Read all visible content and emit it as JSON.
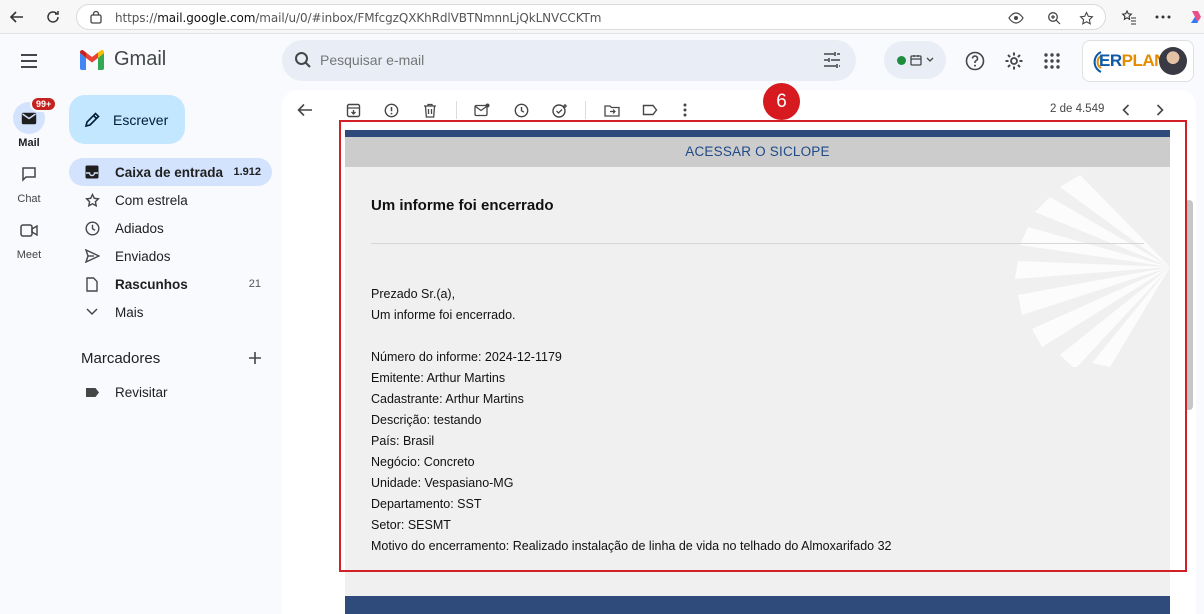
{
  "browser": {
    "url_prefix": "https://",
    "url_host": "mail.google.com",
    "url_path": "/mail/u/0/#inbox/FMfcgzQXKhRdlVBTNmnnLjQkLNVCCKTm"
  },
  "app": {
    "name": "Gmail"
  },
  "rail": {
    "mail_label": "Mail",
    "mail_badge": "99+",
    "chat_label": "Chat",
    "meet_label": "Meet"
  },
  "search": {
    "placeholder": "Pesquisar e-mail"
  },
  "account": {
    "brand_prefix": "ER",
    "brand_suffix": "PLAN"
  },
  "compose": {
    "label": "Escrever"
  },
  "nav": [
    {
      "label": "Caixa de entrada",
      "count": "1.912"
    },
    {
      "label": "Com estrela",
      "count": ""
    },
    {
      "label": "Adiados",
      "count": ""
    },
    {
      "label": "Enviados",
      "count": ""
    },
    {
      "label": "Rascunhos",
      "count": "21"
    },
    {
      "label": "Mais",
      "count": ""
    }
  ],
  "labels": {
    "title": "Marcadores",
    "items": [
      {
        "label": "Revisitar"
      }
    ]
  },
  "pager": {
    "text": "2 de 4.549"
  },
  "annotation": {
    "number": "6"
  },
  "email": {
    "access_link": "ACESSAR O SICLOPE",
    "heading": "Um informe foi encerrado",
    "greeting": "Prezado Sr.(a),",
    "intro": "Um informe foi encerrado.",
    "fields": [
      "Número do informe: 2024-12-1179",
      "Emitente: Arthur Martins",
      "Cadastrante: Arthur Martins",
      "Descrição: testando",
      "País: Brasil",
      "Negócio: Concreto",
      "Unidade: Vespasiano-MG",
      "Departamento: SST",
      "Setor: SESMT",
      "Motivo do encerramento: Realizado instalação de linha de vida no telhado do Almoxarifado 32"
    ]
  },
  "colors": {
    "accent": "#c2e7ff",
    "nav_active": "#d3e3fd",
    "annotation": "#d71920",
    "email_banner": "#2f4b7c"
  }
}
